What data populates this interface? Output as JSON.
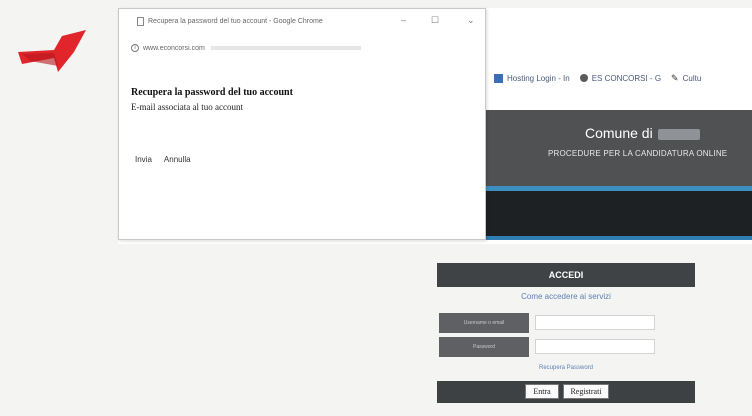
{
  "popup": {
    "tab_title": "Recupera la password del tuo account - Google Chrome",
    "url": "www.econcorsi.com",
    "heading": "Recupera la password del tuo account",
    "email_label": "E-mail associata al tuo account",
    "send_label": "Invia",
    "cancel_label": "Annulla",
    "window_controls": [
      "‒",
      "☐",
      "⌄"
    ]
  },
  "bookmarks": [
    {
      "label": "Hosting Login - In",
      "icon": "grid-icon"
    },
    {
      "label": "ES CONCORSI - G",
      "icon": "globe-icon"
    },
    {
      "label": "Cultu",
      "icon": "pen-icon"
    }
  ],
  "banner": {
    "title": "Comune di",
    "subtitle": "PROCEDURE PER LA CANDIDATURA ONLINE"
  },
  "login": {
    "header": "ACCEDI",
    "link": "Come accedere ai servizi",
    "username_label": "Username o email",
    "password_label": "Password",
    "recover_link": "Recupera Password",
    "enter_button": "Entra",
    "register_button": "Registrati"
  },
  "colors": {
    "annotation_arrow": "#e0262b",
    "banner": "#4f5153",
    "accent": "#3c8fc0",
    "login_header": "#404345"
  }
}
